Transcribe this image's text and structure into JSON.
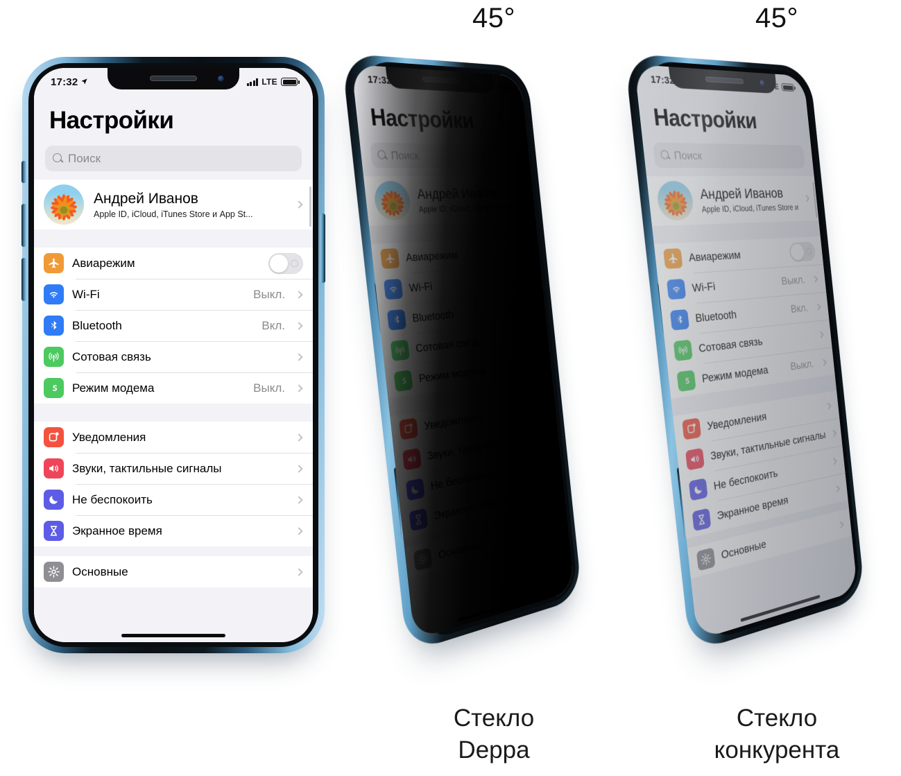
{
  "labels": {
    "angle_left": "45°",
    "angle_right": "45°"
  },
  "captions": {
    "middle_line1": "Стекло",
    "middle_line2": "Deppa",
    "right_line1": "Стекло",
    "right_line2": "конкурента"
  },
  "phone": {
    "status_bar": {
      "time": "17:32",
      "location_icon": "location-arrow-icon",
      "signal_icon": "cellular-bars-icon",
      "network": "LTE",
      "battery_icon": "battery-full-icon"
    },
    "header_title": "Настройки",
    "search": {
      "icon": "search-icon",
      "placeholder": "Поиск"
    },
    "account": {
      "avatar": "flower-avatar",
      "name": "Андрей Иванов",
      "subtitle": "Apple ID, iCloud, iTunes Store и App St...",
      "chevron": "chevron-right-icon"
    },
    "groups": [
      {
        "rows": [
          {
            "icon": "airplane-icon",
            "icon_color": "#f09a37",
            "label": "Авиарежим",
            "value": "",
            "control": "toggle",
            "toggle_on": false
          },
          {
            "icon": "wifi-icon",
            "icon_color": "#2f7cf6",
            "label": "Wi-Fi",
            "value": "Выкл.",
            "control": "chevron"
          },
          {
            "icon": "bluetooth-icon",
            "icon_color": "#2f7cf6",
            "label": "Bluetooth",
            "value": "Вкл.",
            "control": "chevron"
          },
          {
            "icon": "cellular-icon",
            "icon_color": "#4cc95f",
            "label": "Сотовая связь",
            "value": "",
            "control": "chevron"
          },
          {
            "icon": "hotspot-icon",
            "icon_color": "#4cc95f",
            "label": "Режим модема",
            "value": "Выкл.",
            "control": "chevron"
          }
        ]
      },
      {
        "rows": [
          {
            "icon": "notifications-icon",
            "icon_color": "#f3523f",
            "label": "Уведомления",
            "value": "",
            "control": "chevron"
          },
          {
            "icon": "sounds-icon",
            "icon_color": "#ef4559",
            "label": "Звуки, тактильные сигналы",
            "value": "",
            "control": "chevron"
          },
          {
            "icon": "moon-icon",
            "icon_color": "#5d5ce6",
            "label": "Не беспокоить",
            "value": "",
            "control": "chevron"
          },
          {
            "icon": "hourglass-icon",
            "icon_color": "#5d5ce6",
            "label": "Экранное время",
            "value": "",
            "control": "chevron"
          }
        ]
      },
      {
        "rows": [
          {
            "icon": "gear-icon",
            "icon_color": "#8e8e93",
            "label": "Основные",
            "value": "",
            "control": "chevron"
          }
        ]
      }
    ],
    "home_indicator": "home-indicator"
  },
  "colors": {
    "frame_blue": "#5f9fc6",
    "screen_bg": "#f2f2f7",
    "row_bg": "#ffffff",
    "separator": "#e0e0e2",
    "secondary_text": "#8a8a8e"
  }
}
